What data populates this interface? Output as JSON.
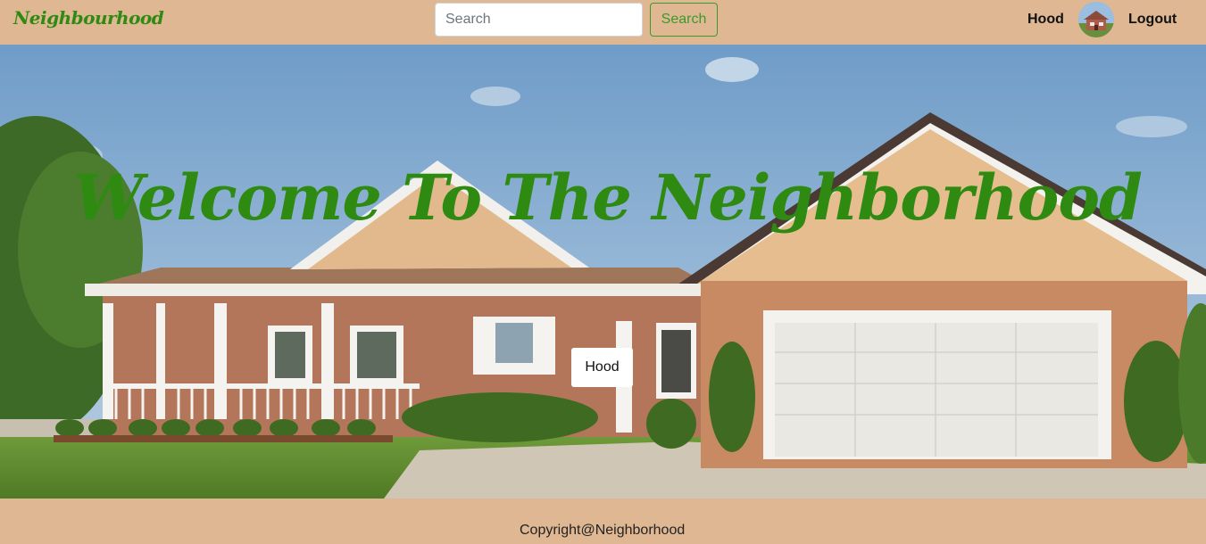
{
  "navbar": {
    "brand": "Neighbourhood",
    "search": {
      "placeholder": "Search",
      "value": ""
    },
    "search_button": "Search",
    "links": {
      "hood": "Hood",
      "logout": "Logout"
    }
  },
  "hero": {
    "title": "Welcome To The Neighborhood",
    "button": "Hood"
  },
  "footer": {
    "copyright": "Copyright@Neighborhood"
  },
  "colors": {
    "accent_green": "#2f8a12",
    "nav_background": "#dfb893",
    "search_button_border": "#3a9a2a"
  }
}
